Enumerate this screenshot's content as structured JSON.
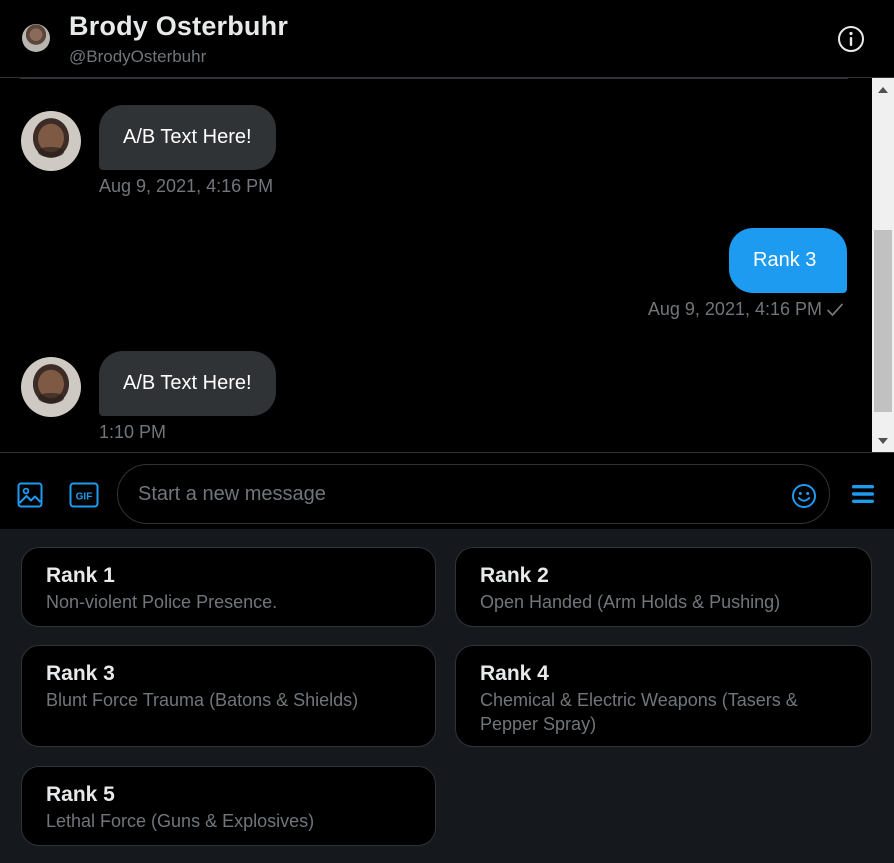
{
  "header": {
    "name": "Brody Osterbuhr",
    "handle": "@BrodyOsterbuhr"
  },
  "messages": [
    {
      "direction": "incoming",
      "text": "A/B Text Here!",
      "timestamp": "Aug 9, 2021, 4:16 PM"
    },
    {
      "direction": "outgoing",
      "text": "Rank 3",
      "timestamp": "Aug 9, 2021, 4:16 PM",
      "read_icon": "checkmark-icon"
    },
    {
      "direction": "incoming",
      "text": "A/B Text Here!",
      "timestamp": "1:10 PM"
    }
  ],
  "composer": {
    "placeholder": "Start a new message",
    "gif_label": "GIF"
  },
  "quick_replies": [
    {
      "title": "Rank 1",
      "description": "Non-violent Police Presence."
    },
    {
      "title": "Rank 2",
      "description": "Open Handed (Arm Holds & Pushing)"
    },
    {
      "title": "Rank 3",
      "description": "Blunt Force Trauma (Batons & Shields)"
    },
    {
      "title": "Rank 4",
      "description": "Chemical & Electric Weapons (Tasers & Pepper Spray)"
    },
    {
      "title": "Rank 5",
      "description": "Lethal Force (Guns & Explosives)"
    }
  ],
  "colors": {
    "accent": "#1d9bf0",
    "background": "#000000",
    "incoming_bubble": "#2f3336",
    "muted_text": "#71767b",
    "quick_reply_panel": "#15181c"
  }
}
